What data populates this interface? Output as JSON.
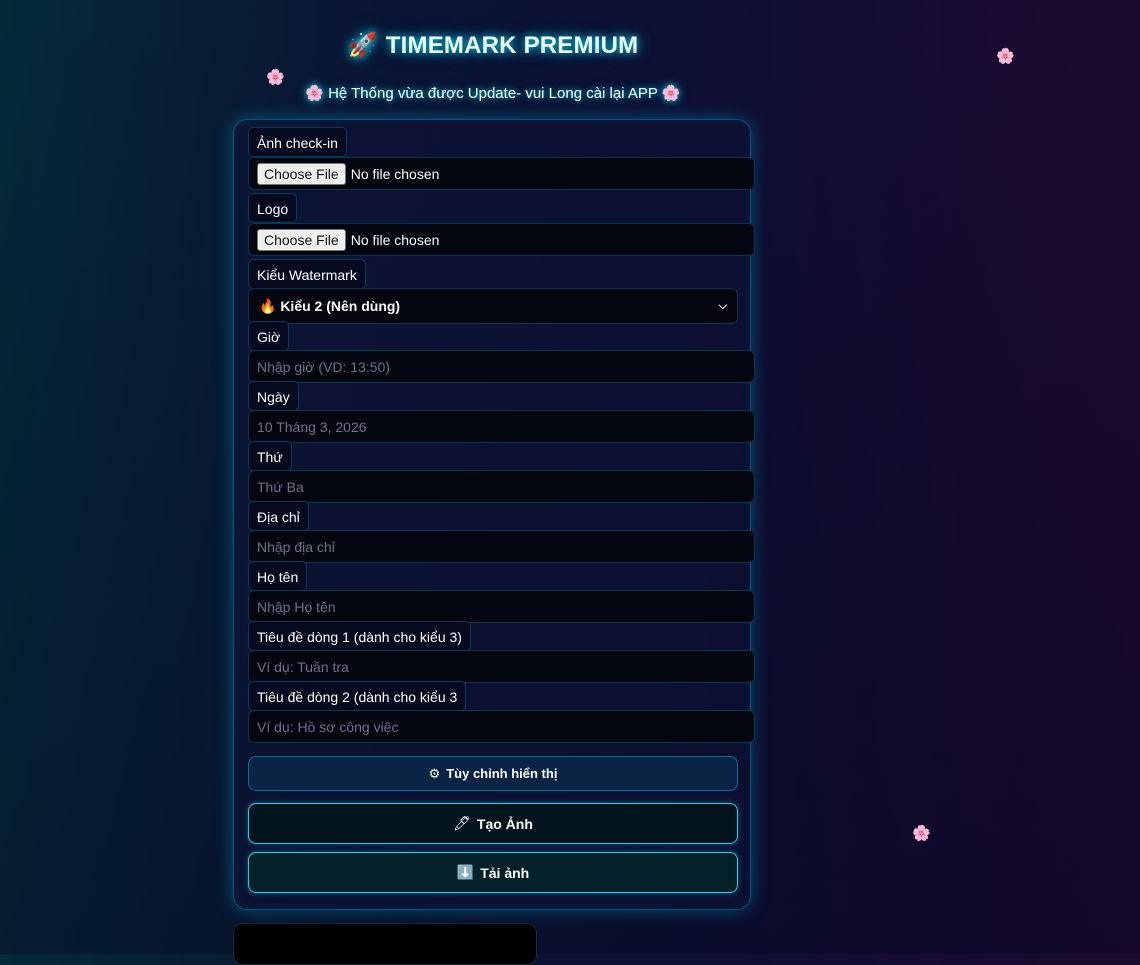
{
  "header": {
    "title_icon": "🚀",
    "title": "TIMEMARK PREMIUM",
    "subtitle_flower": "🌸",
    "subtitle": "Hệ Thống vừa được Update- vui Long cài lại APP"
  },
  "decor": {
    "flower": "🌸"
  },
  "form": {
    "checkin": {
      "label": "Ảnh check-in",
      "button": "Choose File",
      "status": "No file chosen"
    },
    "logo": {
      "label": "Logo",
      "button": "Choose File",
      "status": "No file chosen"
    },
    "watermark": {
      "label": "Kiểu Watermark",
      "selected": "🔥 Kiểu 2 (Nên dùng)"
    },
    "time": {
      "label": "Giờ",
      "placeholder": "Nhập giờ (VD: 13:50)"
    },
    "date": {
      "label": "Ngày",
      "placeholder": "10 Tháng 3, 2026"
    },
    "weekday": {
      "label": "Thứ",
      "placeholder": "Thứ Ba"
    },
    "address": {
      "label": "Địa chỉ",
      "placeholder": "Nhập địa chỉ"
    },
    "name": {
      "label": "Họ tên",
      "placeholder": "Nhập Họ tên"
    },
    "line1": {
      "label": "Tiêu đề dòng 1 (dành cho kiểu 3)",
      "placeholder": "Ví dụ: Tuần tra"
    },
    "line2": {
      "label": "Tiêu đề dòng 2 (dành cho kiểu 3",
      "placeholder": "Ví dụ: Hồ sơ công việc"
    }
  },
  "buttons": {
    "customize": {
      "icon": "⚙",
      "label": "Tùy chỉnh hiển thị"
    },
    "create": {
      "icon": "🖊",
      "label": "Tạo Ảnh"
    },
    "download": {
      "icon": "⬇️",
      "label": "Tải ảnh"
    }
  }
}
